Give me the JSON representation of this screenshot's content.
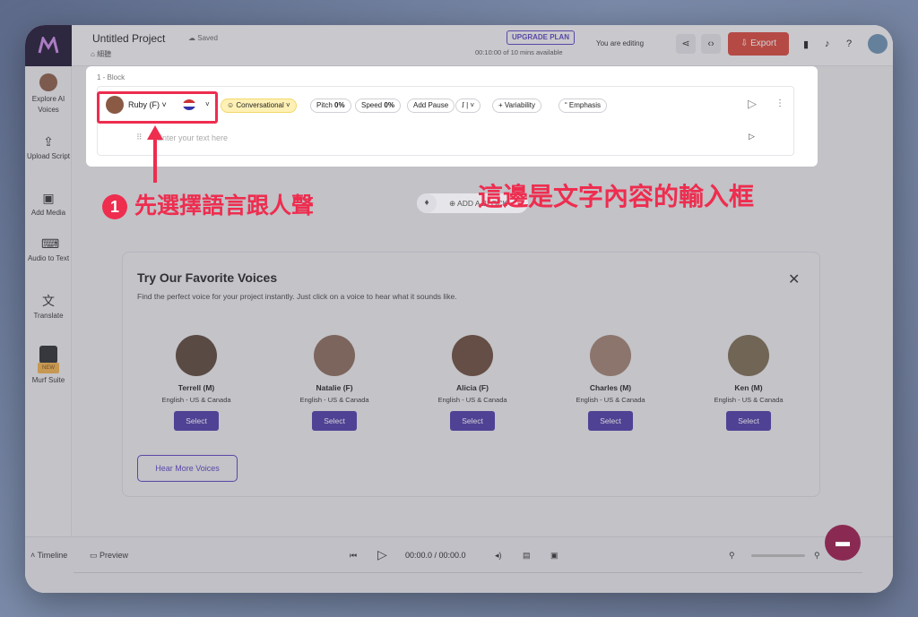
{
  "topbar": {
    "project_title": "Untitled Project",
    "saved": "Saved",
    "breadcrumb": "細聽",
    "upgrade": "UPGRADE PLAN",
    "usage": "00:10:00 of 10 mins available",
    "editing": "You are editing",
    "export": "Export"
  },
  "sidebar": {
    "items": [
      {
        "label": "Explore AI Voices",
        "icon": "avatar-icon"
      },
      {
        "label": "Upload Script",
        "icon": "upload-icon"
      },
      {
        "label": "Add Media",
        "icon": "media-icon"
      },
      {
        "label": "Audio to Text",
        "icon": "audio-text-icon"
      },
      {
        "label": "Translate",
        "icon": "translate-icon"
      },
      {
        "label": "Murf Suite",
        "icon": "suite-icon",
        "badge": "NEW"
      }
    ]
  },
  "block": {
    "label": "1 - Block",
    "voice": "Ruby (F)",
    "style": "Conversational",
    "pitch_label": "Pitch",
    "pitch_value": "0%",
    "speed_label": "Speed",
    "speed_value": "0%",
    "add_pause": "Add Pause",
    "variability": "Variability",
    "emphasis": "Emphasis",
    "placeholder": "Enter your text here",
    "add_block": "ADD A BLOCK"
  },
  "annotations": {
    "step_number": "1",
    "step_text": "先選擇語言跟人聲",
    "input_note": "這邊是文字內容的輸入框"
  },
  "favorites": {
    "title": "Try Our Favorite Voices",
    "subtitle": "Find the perfect voice for your project instantly. Just click on a voice to hear what it sounds like.",
    "hear_more": "Hear More Voices",
    "voices": [
      {
        "name": "Terrell (M)",
        "locale": "English - US & Canada",
        "select": "Select"
      },
      {
        "name": "Natalie (F)",
        "locale": "English - US & Canada",
        "select": "Select"
      },
      {
        "name": "Alicia (F)",
        "locale": "English - US & Canada",
        "select": "Select"
      },
      {
        "name": "Charles (M)",
        "locale": "English - US & Canada",
        "select": "Select"
      },
      {
        "name": "Ken (M)",
        "locale": "English - US & Canada",
        "select": "Select"
      }
    ]
  },
  "timeline": {
    "label": "Timeline",
    "preview": "Preview",
    "time": "00:00.0 / 00:00.0"
  }
}
